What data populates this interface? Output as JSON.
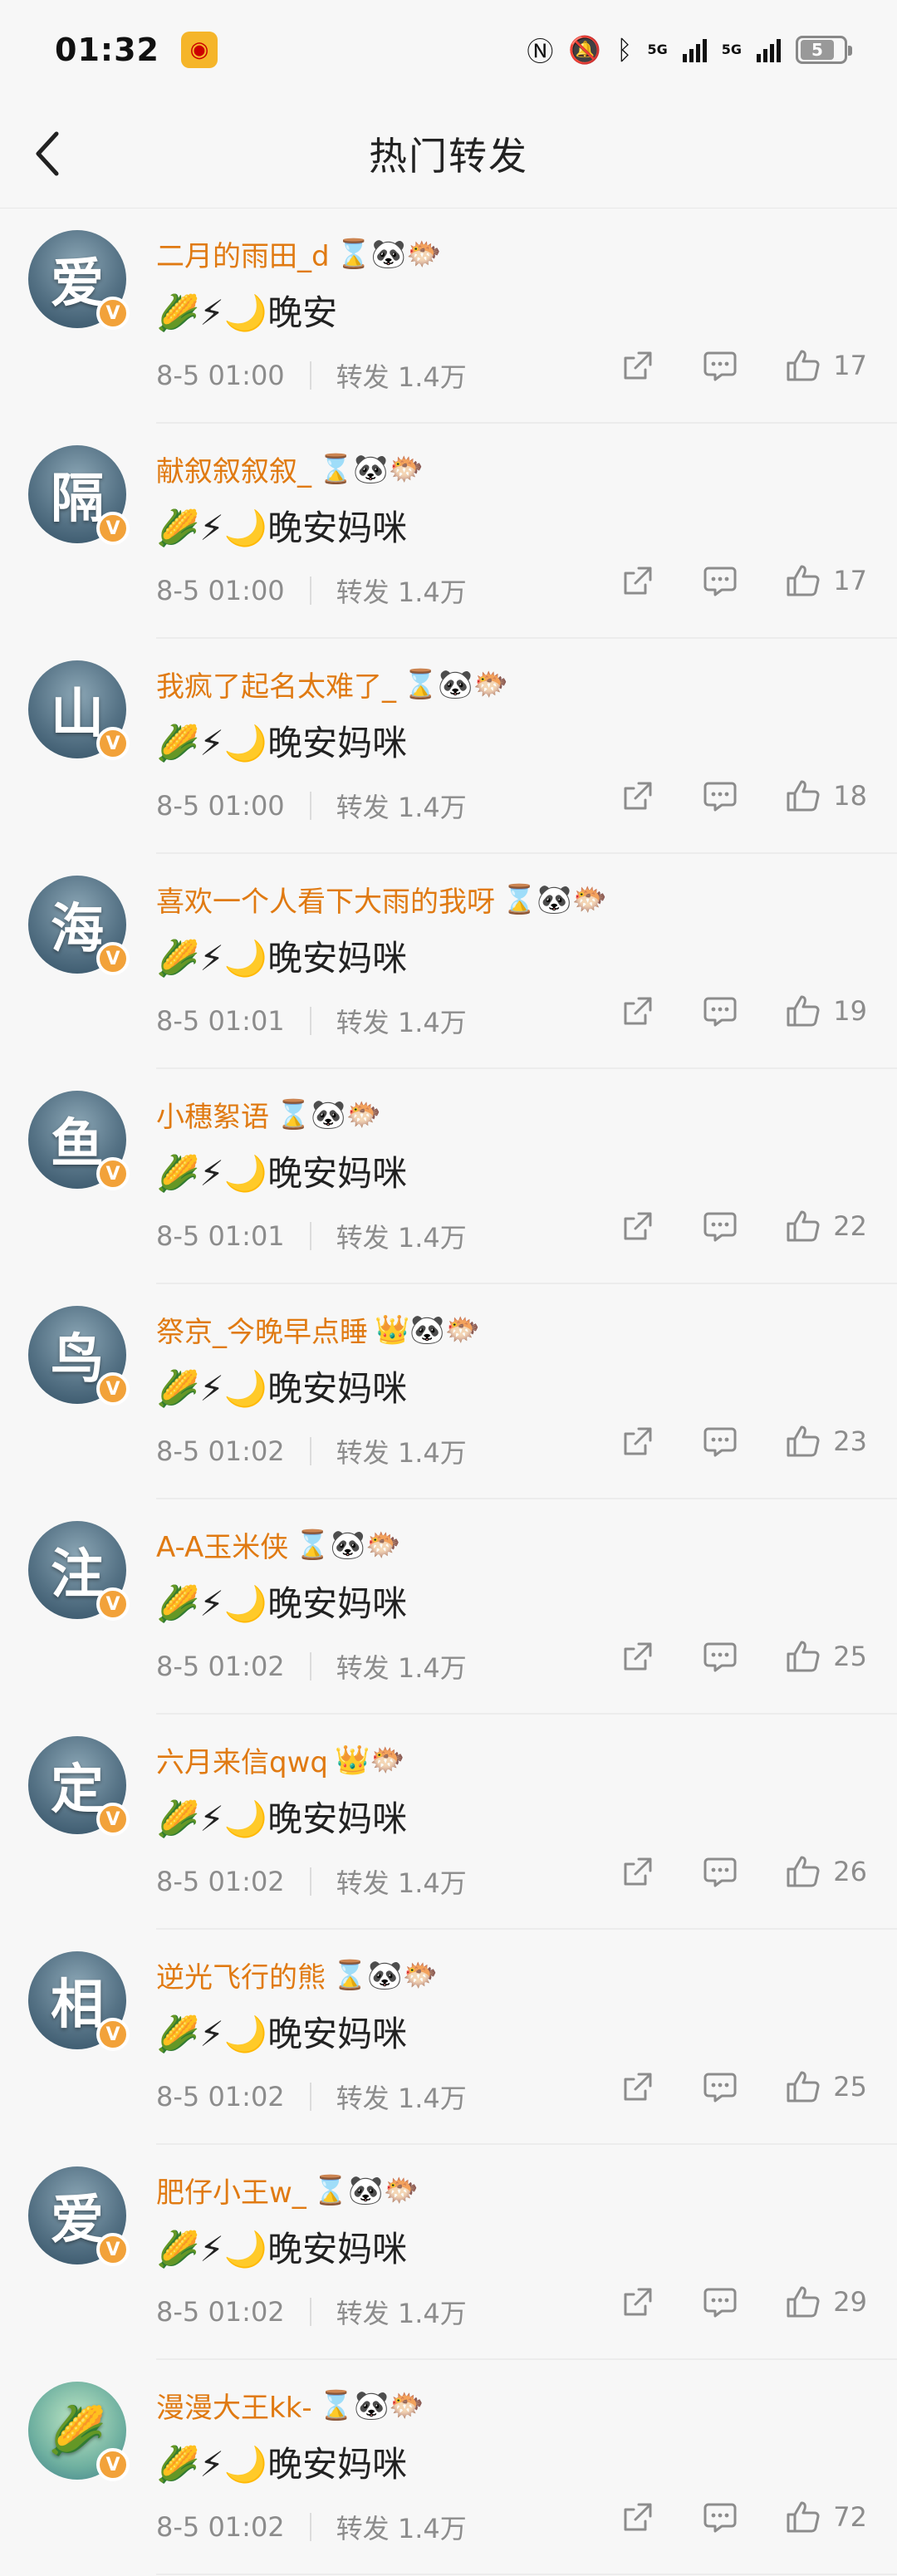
{
  "status_bar": {
    "time": "01:32",
    "battery": "5",
    "network_1": "5G",
    "network_2": "5G"
  },
  "header": {
    "title": "热门转发"
  },
  "icons": {
    "back": "chevron-left-icon",
    "share": "share-icon",
    "comment": "comment-icon",
    "like": "thumbs-up-icon",
    "verified": "verified-badge-icon"
  },
  "colors": {
    "username": "#e07a12",
    "badge": "#f2a23a",
    "meta": "#8c8c8c"
  },
  "posts": [
    {
      "avatar_char": "爱",
      "username": "二月的雨田_d",
      "badges": "⌛🐼🐡",
      "content": "🌽⚡🌙晚安",
      "time": "8-5 01:00",
      "repost": "转发 1.4万",
      "likes": "17"
    },
    {
      "avatar_char": "隔",
      "username": "献叙叙叙叙_",
      "badges": "⌛🐼🐡",
      "content": "🌽⚡🌙晚安妈咪",
      "time": "8-5 01:00",
      "repost": "转发 1.4万",
      "likes": "17"
    },
    {
      "avatar_char": "山",
      "username": "我疯了起名太难了_",
      "badges": "⌛🐼🐡",
      "content": "🌽⚡🌙晚安妈咪",
      "time": "8-5 01:00",
      "repost": "转发 1.4万",
      "likes": "18"
    },
    {
      "avatar_char": "海",
      "username": "喜欢一个人看下大雨的我呀",
      "badges": "⌛🐼🐡",
      "content": "🌽⚡🌙晚安妈咪",
      "time": "8-5 01:01",
      "repost": "转发 1.4万",
      "likes": "19"
    },
    {
      "avatar_char": "鱼",
      "username": "小穗絮语",
      "badges": "⌛🐼🐡",
      "content": "🌽⚡🌙晚安妈咪",
      "time": "8-5 01:01",
      "repost": "转发 1.4万",
      "likes": "22"
    },
    {
      "avatar_char": "鸟",
      "username": "祭京_今晚早点睡",
      "badges": "👑🐼🐡",
      "content": "🌽⚡🌙晚安妈咪",
      "time": "8-5 01:02",
      "repost": "转发 1.4万",
      "likes": "23"
    },
    {
      "avatar_char": "注",
      "username": "A-A玉米侠",
      "badges": "⌛🐼🐡",
      "content": "🌽⚡🌙晚安妈咪",
      "time": "8-5 01:02",
      "repost": "转发 1.4万",
      "likes": "25"
    },
    {
      "avatar_char": "定",
      "username": "六月来信qwq",
      "badges": "👑🐡",
      "content": "🌽⚡🌙晚安妈咪",
      "time": "8-5 01:02",
      "repost": "转发 1.4万",
      "likes": "26"
    },
    {
      "avatar_char": "相",
      "username": "逆光飞行的熊",
      "badges": "⌛🐼🐡",
      "content": "🌽⚡🌙晚安妈咪",
      "time": "8-5 01:02",
      "repost": "转发 1.4万",
      "likes": "25"
    },
    {
      "avatar_char": "爱",
      "username": "肥仔小王w_",
      "badges": "⌛🐼🐡",
      "content": "🌽⚡🌙晚安妈咪",
      "time": "8-5 01:02",
      "repost": "转发 1.4万",
      "likes": "29"
    },
    {
      "avatar_char": "🌽",
      "username": "漫漫大王kk-",
      "badges": "⌛🐼🐡",
      "content": "🌽⚡🌙晚安妈咪",
      "time": "8-5 01:02",
      "repost": "转发 1.4万",
      "likes": "72"
    }
  ]
}
